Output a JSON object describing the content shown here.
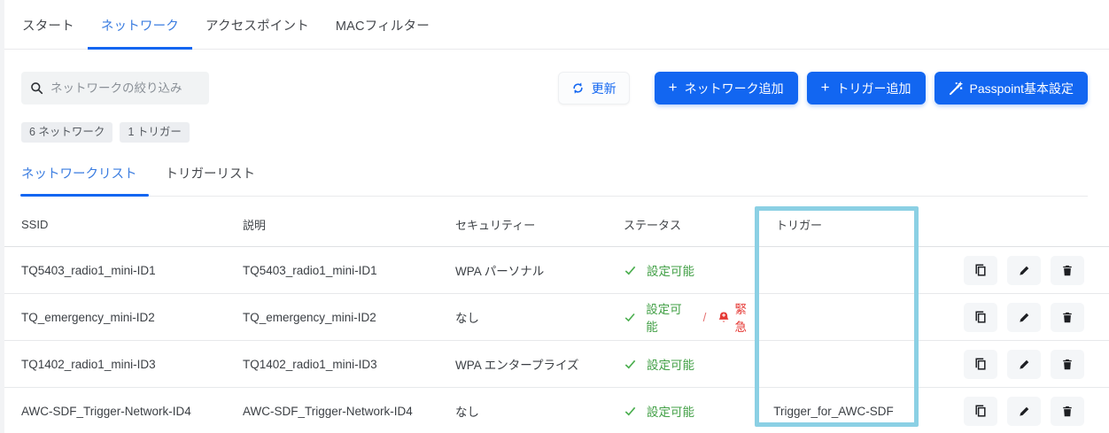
{
  "tabs": [
    {
      "label": "スタート",
      "active": false
    },
    {
      "label": "ネットワーク",
      "active": true
    },
    {
      "label": "アクセスポイント",
      "active": false
    },
    {
      "label": "MACフィルター",
      "active": false
    }
  ],
  "toolbar": {
    "search_placeholder": "ネットワークの絞り込み",
    "refresh_label": "更新",
    "plus": "+",
    "add_network_label": "ネットワーク追加",
    "add_trigger_label": "トリガー追加",
    "passpoint_label": "Passpoint基本設定"
  },
  "summary_badges": [
    {
      "label": "6 ネットワーク"
    },
    {
      "label": "1 トリガー"
    }
  ],
  "list_tabs": [
    {
      "label": "ネットワークリスト",
      "active": true
    },
    {
      "label": "トリガーリスト",
      "active": false
    }
  ],
  "table": {
    "columns": [
      "SSID",
      "説明",
      "セキュリティー",
      "ステータス",
      "トリガー"
    ],
    "rows": [
      {
        "ssid": "TQ5403_radio1_mini-ID1",
        "description": "TQ5403_radio1_mini-ID1",
        "security": "WPA パーソナル",
        "status": "設定可能",
        "trigger": ""
      },
      {
        "ssid": "TQ_emergency_mini-ID2",
        "description": "TQ_emergency_mini-ID2",
        "security": "なし",
        "status": "設定可能",
        "status_separator": "/",
        "emergency": "緊急",
        "trigger": ""
      },
      {
        "ssid": "TQ1402_radio1_mini-ID3",
        "description": "TQ1402_radio1_mini-ID3",
        "security": "WPA エンタープライズ",
        "status": "設定可能",
        "trigger": ""
      },
      {
        "ssid": "AWC-SDF_Trigger-Network-ID4",
        "description": "AWC-SDF_Trigger-Network-ID4",
        "security": "なし",
        "status": "設定可能",
        "trigger": "Trigger_for_AWC-SDF"
      }
    ]
  },
  "colors": {
    "primary": "#1266f1",
    "tab_active": "#3a7ce0",
    "success": "#43a047",
    "danger": "#e53935",
    "highlight_box": "#8bd0e4"
  }
}
